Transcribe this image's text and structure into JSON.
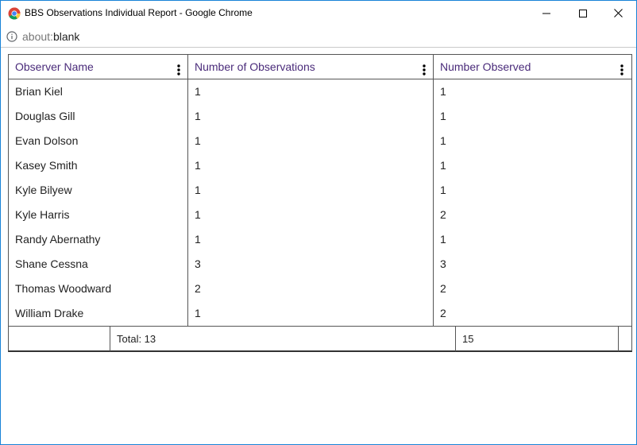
{
  "window": {
    "title": "BBS Observations Individual Report - Google Chrome",
    "app_icon": "chrome-icon",
    "controls": [
      "minimize-icon",
      "maximize-icon",
      "close-icon"
    ]
  },
  "address_bar": {
    "icon": "info-icon",
    "scheme": "about:",
    "path": "blank"
  },
  "table": {
    "columns": [
      {
        "label": "Observer Name",
        "menu_icon": "kebab-menu-icon"
      },
      {
        "label": "Number of Observations",
        "menu_icon": "kebab-menu-icon"
      },
      {
        "label": "Number Observed",
        "menu_icon": "kebab-menu-icon"
      }
    ],
    "rows": [
      {
        "name": "Brian Kiel",
        "observations": "1",
        "observed": "1"
      },
      {
        "name": "Douglas Gill",
        "observations": "1",
        "observed": "1"
      },
      {
        "name": "Evan Dolson",
        "observations": "1",
        "observed": "1"
      },
      {
        "name": "Kasey Smith",
        "observations": "1",
        "observed": "1"
      },
      {
        "name": "Kyle Bilyew",
        "observations": "1",
        "observed": "1"
      },
      {
        "name": "Kyle Harris",
        "observations": "1",
        "observed": "2"
      },
      {
        "name": "Randy Abernathy",
        "observations": "1",
        "observed": "1"
      },
      {
        "name": "Shane Cessna",
        "observations": "3",
        "observed": "3"
      },
      {
        "name": "Thomas Woodward",
        "observations": "2",
        "observed": "2"
      },
      {
        "name": "William Drake",
        "observations": "1",
        "observed": "2"
      }
    ],
    "footer": {
      "total_label": "Total: 13",
      "observed_total": "15"
    }
  },
  "colors": {
    "header_text": "#4a2b7a",
    "window_border": "#1883d7"
  }
}
